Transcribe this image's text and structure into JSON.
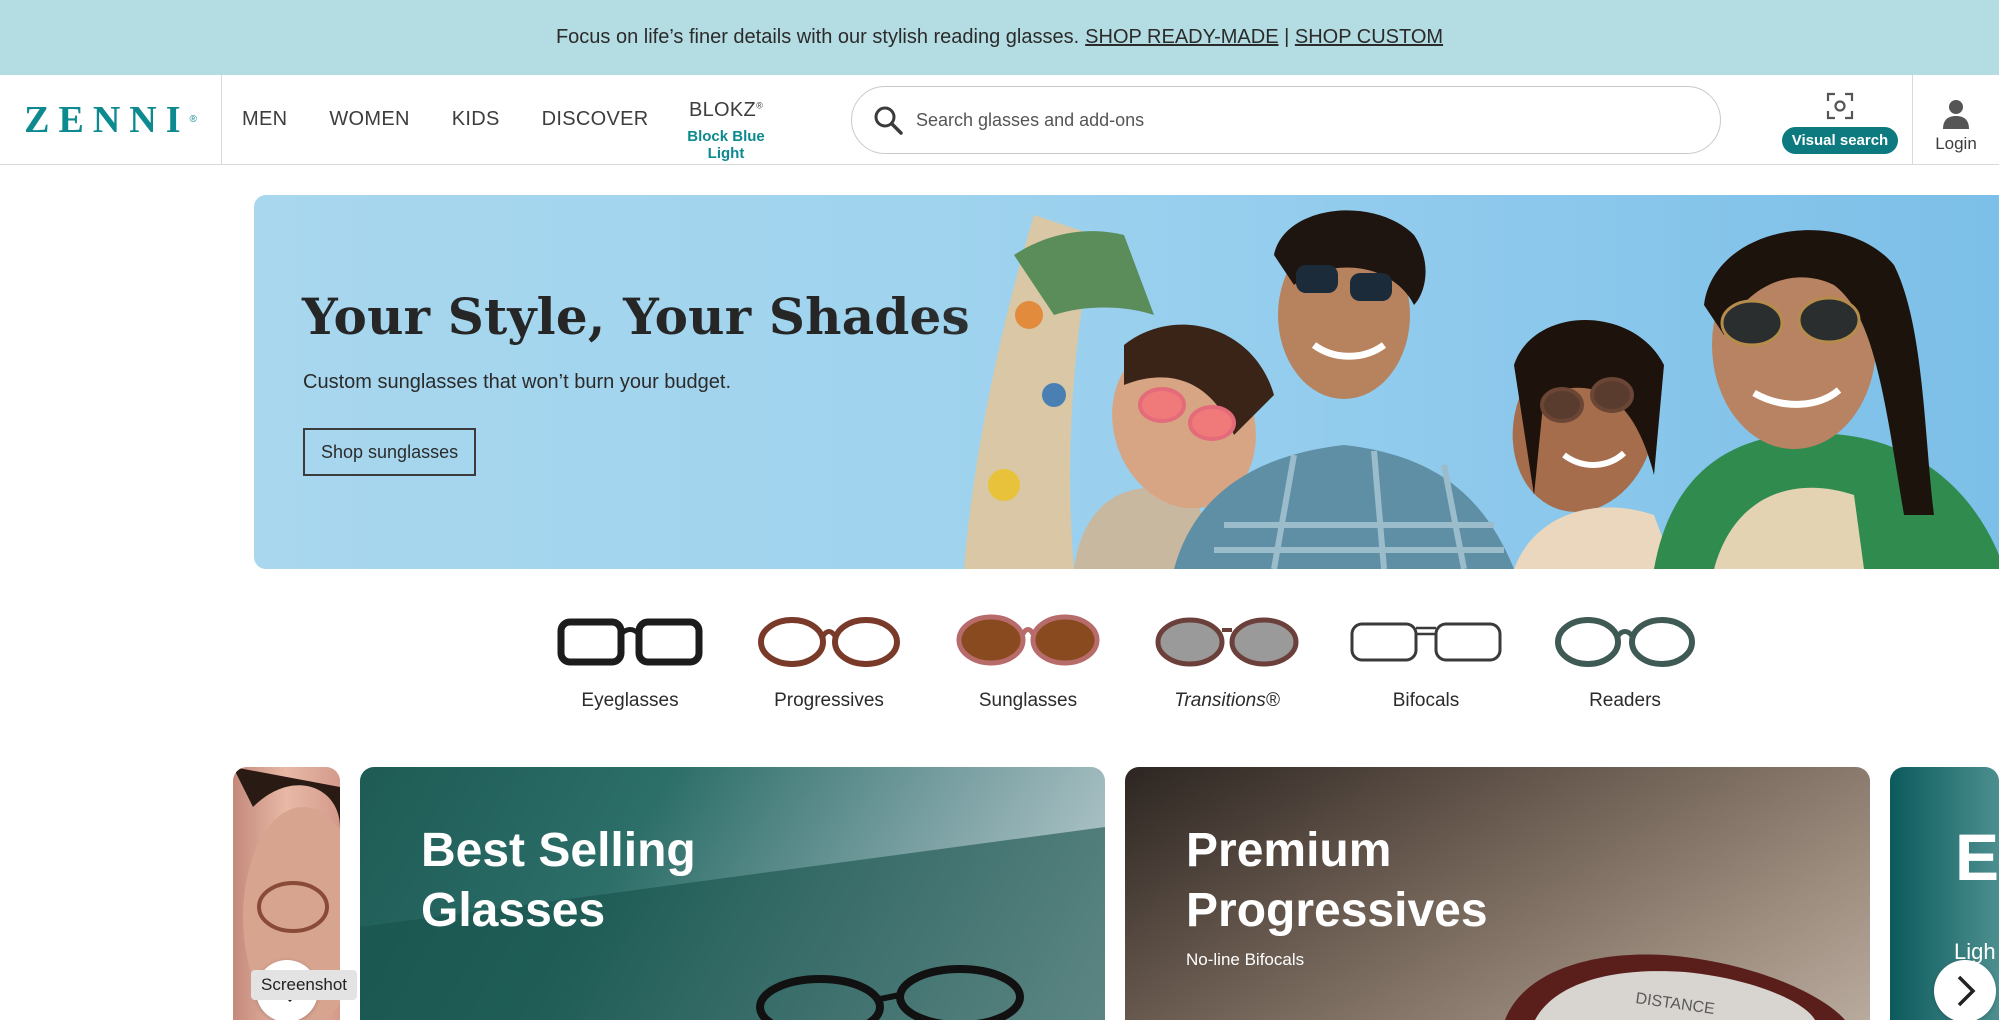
{
  "promo": {
    "text": "Focus on life’s finer details with our stylish reading glasses.",
    "link_ready": "SHOP READY-MADE",
    "separator": "|",
    "link_custom": "SHOP CUSTOM"
  },
  "header": {
    "logo_text": "ZENNI",
    "nav": [
      "MEN",
      "WOMEN",
      "KIDS",
      "DISCOVER"
    ],
    "blokz_title": "BLOKZ",
    "blokz_mark": "®",
    "blokz_subtitle": "Block Blue Light",
    "search_placeholder": "Search glasses and add-ons",
    "visual_search_label": "Visual search",
    "login_label": "Login"
  },
  "hero": {
    "title": "Your Style, Your Shades",
    "subtitle": "Custom sunglasses that won’t burn your budget.",
    "button": "Shop sunglasses"
  },
  "categories": [
    "Eyeglasses",
    "Progressives",
    "Sunglasses",
    "Transitions®",
    "Bifocals",
    "Readers"
  ],
  "cards": {
    "best_line1": "Best Selling",
    "best_line2": "Glasses",
    "prem_line1": "Premium",
    "prem_line2": "Progressives",
    "prem_sub": "No-line Bifocals",
    "prem_lens_text": "DISTANCE",
    "next_title": "E",
    "next_sub": "Ligh"
  },
  "tooltip": "Screenshot",
  "colors": {
    "promo_bg": "#b4dce3",
    "brand_teal": "#0d8a8f",
    "hero_bg": "#9fd3ee"
  }
}
